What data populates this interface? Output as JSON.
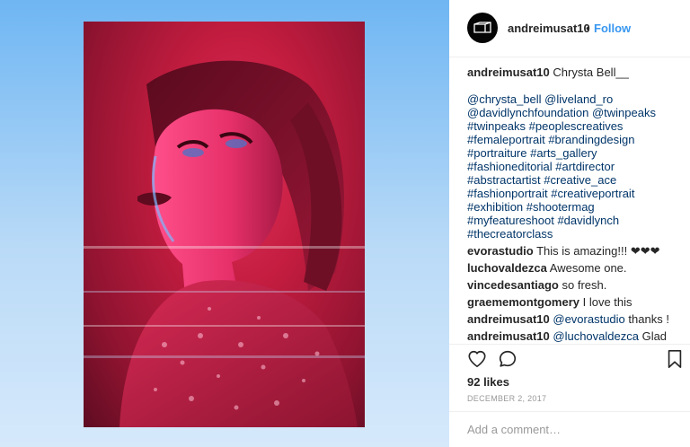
{
  "colors": {
    "link": "#3897f0",
    "hashtag": "#003569",
    "text": "#262626",
    "muted": "#999999",
    "backdrop": "#6fb6f3"
  },
  "header": {
    "username": "andreimusat10",
    "separator": "•",
    "follow_label": "Follow",
    "avatar_icon": "cube-logo-icon"
  },
  "caption": {
    "username": "andreimusat10",
    "text": " Chrysta Bell__",
    "tag_lines": [
      "@chrysta_bell @liveland_ro",
      "@davidlynchfoundation @twinpeaks",
      "#twinpeaks #peoplescreatives",
      "#femaleportrait #brandingdesign",
      "#portraiture #arts_gallery",
      "#fashioneditorial #artdirector",
      "#abstractartist #creative_ace",
      "#fashionportrait #creativeportrait",
      "#exhibition #shootermag",
      "#myfeatureshoot #davidlynch",
      "#thecreatorclass"
    ]
  },
  "comments": [
    {
      "username": "evorastudio",
      "text": " This is amazing!!! ❤❤❤"
    },
    {
      "username": "luchovaldezca",
      "text": " Awesome one."
    },
    {
      "username": "vincedesantiago",
      "text": " so fresh."
    },
    {
      "username": "graememontgomery",
      "text": " I love this"
    },
    {
      "username": "andreimusat10",
      "mention": " @evorastudio",
      "text": " thanks !"
    },
    {
      "username": "andreimusat10",
      "mention": " @luchovaldezca",
      "text": " Glad"
    }
  ],
  "actions": {
    "like_icon": "heart-icon",
    "comment_icon": "comment-bubble-icon",
    "save_icon": "bookmark-icon"
  },
  "likes_text": "92 likes",
  "date_text": "DECEMBER 2, 2017",
  "comment_input": {
    "placeholder": "Add a comment…",
    "value": ""
  }
}
